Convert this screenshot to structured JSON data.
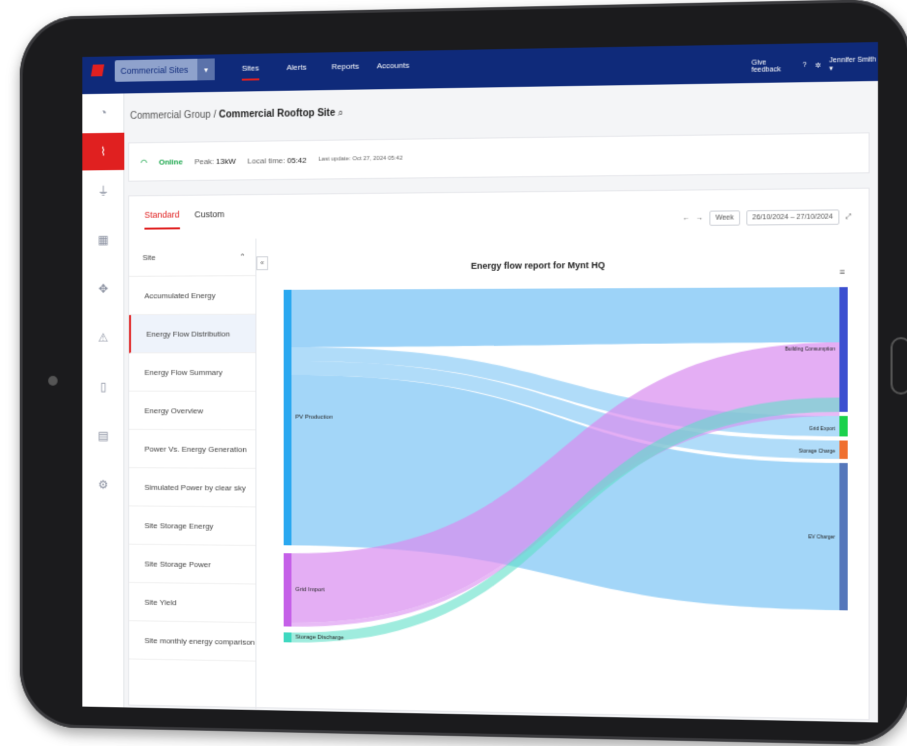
{
  "topbar": {
    "site_select": "Commercial Sites",
    "tabs": [
      "Sites",
      "Alerts",
      "Reports",
      "Accounts"
    ],
    "give_feedback": "Give feedback",
    "user": "Jennifer Smith ▾"
  },
  "breadcrumb": {
    "group": "Commercial Group",
    "sep": "/",
    "site": "Commercial Rooftop Site"
  },
  "status": {
    "online": "Online",
    "peak_label": "Peak:",
    "peak_value": "13kW",
    "local_label": "Local time:",
    "local_value": "05:42",
    "last_update": "Last update: Oct 27, 2024 05:42"
  },
  "tabs": {
    "standard": "Standard",
    "custom": "Custom"
  },
  "toolbar": {
    "range": "Week",
    "dates": "26/10/2024 – 27/10/2024"
  },
  "list": {
    "header": "Site",
    "items": [
      "Accumulated Energy",
      "Energy Flow Distribution",
      "Energy Flow Summary",
      "Energy Overview",
      "Power Vs. Energy Generation",
      "Simulated Power by clear sky",
      "Site Storage Energy",
      "Site Storage Power",
      "Site Yield",
      "Site monthly energy comparison"
    ]
  },
  "chart_data": {
    "type": "sankey",
    "title": "Energy flow report for Mynt HQ",
    "sources": [
      "PV Production",
      "Grid Import",
      "Storage Discharge"
    ],
    "targets": [
      "Building Consumption",
      "Grid Export",
      "Storage Charge",
      "EV Charger"
    ]
  },
  "colors": {
    "nav": "#0f2a7a",
    "accent": "#e02020",
    "pv": "#7cc4f5",
    "grid": "#d98cf0",
    "storage": "#5fe0c8"
  }
}
